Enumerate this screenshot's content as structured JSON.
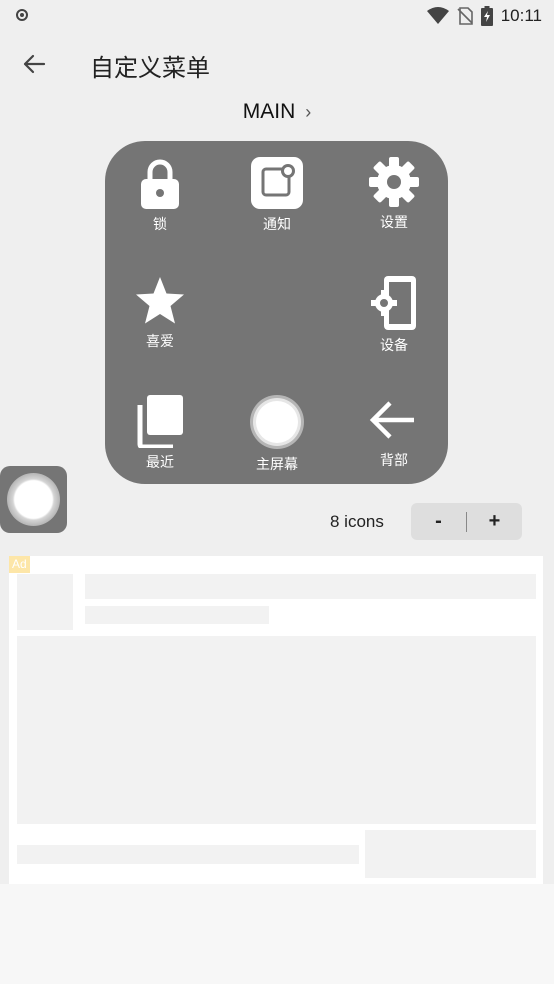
{
  "status_bar": {
    "time": "10:11"
  },
  "app_bar": {
    "title": "自定义菜单"
  },
  "menu": {
    "name": "MAIN",
    "items": [
      {
        "label": "锁",
        "icon": "lock-icon"
      },
      {
        "label": "通知",
        "icon": "notification-icon"
      },
      {
        "label": "设置",
        "icon": "gear-icon"
      },
      {
        "label": "喜爱",
        "icon": "star-icon"
      },
      {
        "label": "设备",
        "icon": "device-icon"
      },
      {
        "label": "最近",
        "icon": "recent-icon"
      },
      {
        "label": "主屏幕",
        "icon": "home-icon"
      },
      {
        "label": "背部",
        "icon": "back-arrow-icon"
      }
    ]
  },
  "icon_count": {
    "label": "8 icons",
    "minus": "-",
    "plus": "+"
  },
  "ad": {
    "badge": "Ad"
  }
}
